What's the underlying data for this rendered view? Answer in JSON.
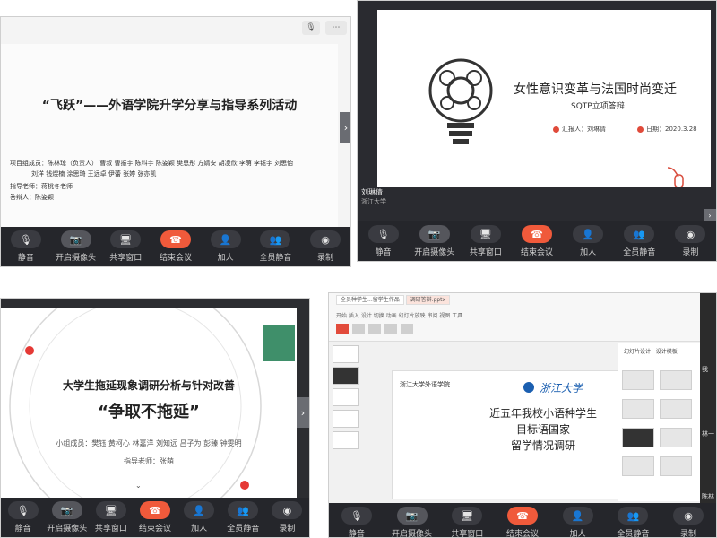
{
  "toolbar": {
    "buttons": [
      {
        "label": "静音",
        "icon": "mic-icon",
        "glyph": "🎙"
      },
      {
        "label": "开启摄像头",
        "icon": "camera-icon",
        "glyph": "📷"
      },
      {
        "label": "共享窗口",
        "icon": "screen-share-icon",
        "glyph": "🖥"
      },
      {
        "label": "结束会议",
        "icon": "hangup-icon",
        "glyph": "☎"
      },
      {
        "label": "加人",
        "icon": "add-person-icon",
        "glyph": "👤"
      },
      {
        "label": "全员静音",
        "icon": "mute-all-icon",
        "glyph": "👥"
      },
      {
        "label": "录制",
        "icon": "record-icon",
        "glyph": "◉"
      }
    ]
  },
  "panel1": {
    "title": "“飞跃”——外语学院升学分享与指导系列活动",
    "members_line1": "项目组成员：陈林琼（负责人） 曹叔 曹振宇 陈科宇 陈姿颖 樊思彤 方婧安 胡凌欣 李萌 李钰宇 刘思怡",
    "members_line2": "刘洋 钱煜楠 涂思琦 王远卓 伊蕾 张婷 张亦凯",
    "advisor": "指导老师：蒋桃冬老师",
    "speaker": "答辩人：陈姿颖"
  },
  "panel2": {
    "title": "女性意识变革与法国时尚变迁",
    "subtitle": "SQTP立项答辩",
    "presenter": "汇报人：刘琳倩",
    "date": "日期：2020.3.28",
    "participant_name": "刘琳倩",
    "participant_org": "浙江大学"
  },
  "panel3": {
    "title": "大学生拖延现象调研分析与针对改善",
    "slogan": "“争取不拖延”",
    "members": "小组成员：樊钰 黄柯心 林嘉洋 刘知远 吕子为 彭臻 钟雯明",
    "advisor": "指导老师：张萌"
  },
  "panel4": {
    "tab1": "全员种学生...留学生作品",
    "tab2": "调研答辩.pptx",
    "ribbon": "开始  插入  设计  切换  动画  幻灯片放映  审阅  视图  工具",
    "school": "浙江大学外语学院",
    "university": "浙江大学",
    "title_line1": "近五年我校小语种学生",
    "title_line2": "目标语国家",
    "title_line3": "留学情况调研",
    "right_title": "幻灯片设计 · 设计模板",
    "side_names": [
      "我",
      "林一",
      "陈林"
    ]
  }
}
